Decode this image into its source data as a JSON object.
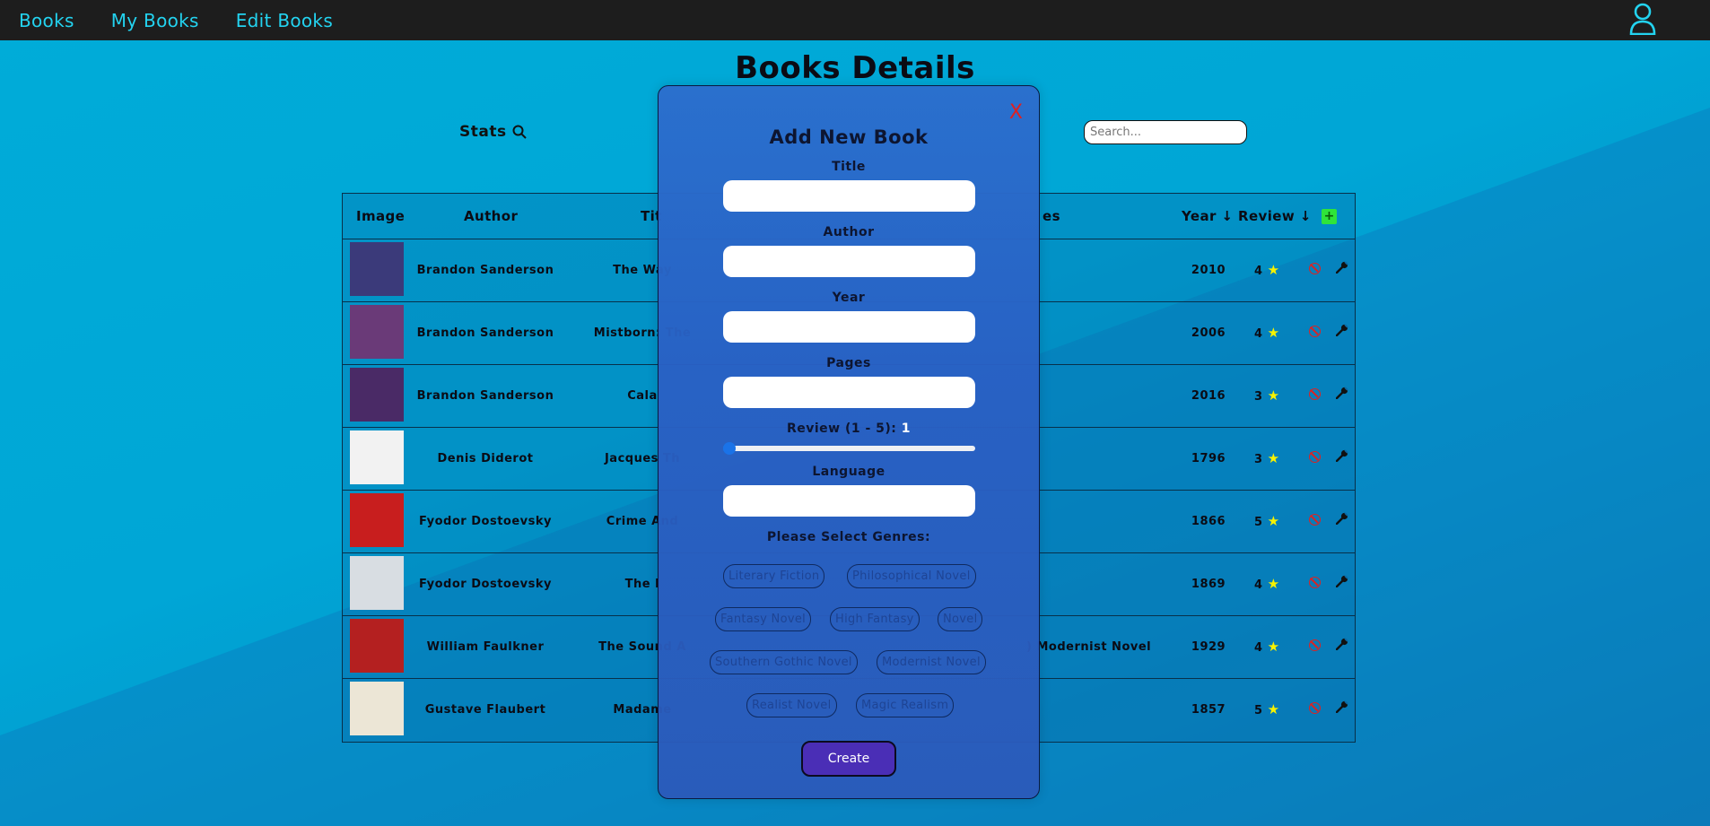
{
  "nav": {
    "links": [
      "Books",
      "My Books",
      "Edit Books"
    ],
    "user_icon": "user-icon"
  },
  "page": {
    "title": "Books Details",
    "stats_label": "Stats",
    "search_placeholder": "Search..."
  },
  "table": {
    "columns": {
      "image": "Image",
      "author": "Author",
      "title_partial": "Tit",
      "genres_partial": "es",
      "year": "Year",
      "review": "Review"
    },
    "rows": [
      {
        "author": "Brandon Sanderson",
        "title": "The Way",
        "genres": "",
        "year": "2010",
        "review": "4",
        "cover_color": "#3b3a7a"
      },
      {
        "author": "Brandon Sanderson",
        "title": "Mistborn: The",
        "genres": "",
        "year": "2006",
        "review": "4",
        "cover_color": "#6a3a78"
      },
      {
        "author": "Brandon Sanderson",
        "title": "Cala",
        "genres": "",
        "year": "2016",
        "review": "3",
        "cover_color": "#4a2a66"
      },
      {
        "author": "Denis Diderot",
        "title": "Jacques Th",
        "genres": "",
        "year": "1796",
        "review": "3",
        "cover_color": "#f2f2f2"
      },
      {
        "author": "Fyodor Dostoevsky",
        "title": "Crime And",
        "genres": "",
        "year": "1866",
        "review": "5",
        "cover_color": "#c81e1e"
      },
      {
        "author": "Fyodor Dostoevsky",
        "title": "The I",
        "genres": "",
        "year": "1869",
        "review": "4",
        "cover_color": "#d8dde2"
      },
      {
        "author": "William Faulkner",
        "title": "The Sound A",
        "genres": ")  Modernist Novel",
        "year": "1929",
        "review": "4",
        "cover_color": "#b42020"
      },
      {
        "author": "Gustave Flaubert",
        "title": "Madame",
        "genres": "",
        "year": "1857",
        "review": "5",
        "cover_color": "#ece6d6"
      }
    ]
  },
  "modal": {
    "title": "Add New Book",
    "close_label": "X",
    "fields": {
      "title": "Title",
      "author": "Author",
      "year": "Year",
      "pages": "Pages",
      "review": "Review (1 - 5):",
      "review_value": "1",
      "language": "Language"
    },
    "review_min": 1,
    "review_max": 5,
    "review_current": 1,
    "genres_heading": "Please Select Genres:",
    "genres": [
      "Literary Fiction",
      "Philosophical Novel",
      "Fantasy Novel",
      "High Fantasy",
      "Novel",
      "Southern Gothic Novel",
      "Modernist Novel",
      "Realist Novel",
      "Magic Realism"
    ],
    "create_label": "Create"
  },
  "colors": {
    "nav_bg": "#1d1d1d",
    "nav_link": "#23d3f0",
    "bg": "#00acd8",
    "modal_bg": "#2b6ecd",
    "create_bg": "#4a2eb6",
    "star": "#f7f200",
    "delete": "#dd2222",
    "add": "#2fe43a"
  }
}
